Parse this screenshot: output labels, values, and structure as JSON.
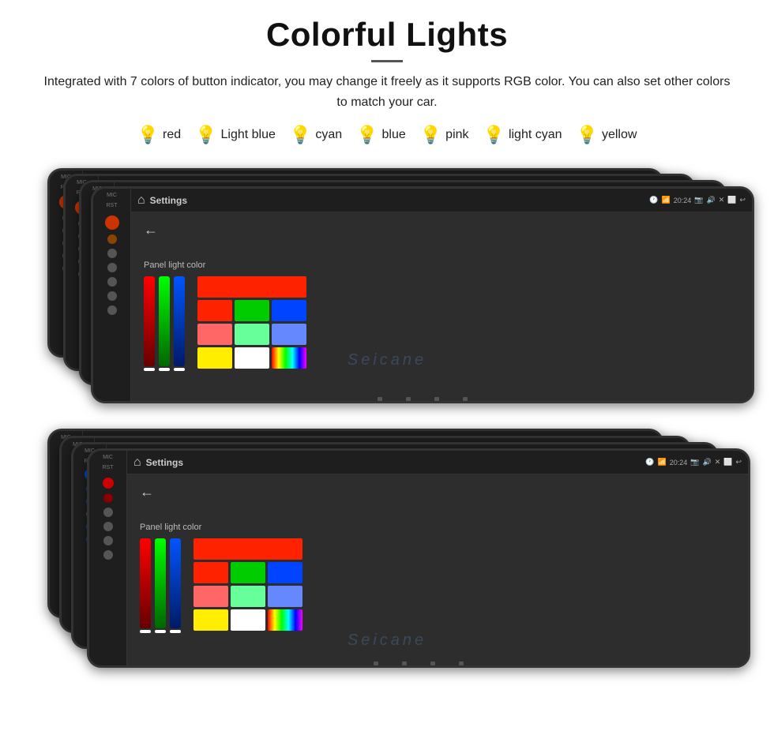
{
  "header": {
    "title": "Colorful Lights",
    "divider": true,
    "description": "Integrated with 7 colors of button indicator, you may change it freely as it supports RGB color. You can also set other colors to match your car."
  },
  "colors": [
    {
      "label": "red",
      "color": "#ff2244",
      "bulb": "🔴"
    },
    {
      "label": "Light blue",
      "color": "#88ccff",
      "bulb": "🔵"
    },
    {
      "label": "cyan",
      "color": "#00eeff",
      "bulb": "🔵"
    },
    {
      "label": "blue",
      "color": "#3344ff",
      "bulb": "🔵"
    },
    {
      "label": "pink",
      "color": "#ff88cc",
      "bulb": "🔴"
    },
    {
      "label": "light cyan",
      "color": "#aaeeff",
      "bulb": "🔵"
    },
    {
      "label": "yellow",
      "color": "#ffee00",
      "bulb": "🟡"
    }
  ],
  "panel": {
    "title": "Panel light color"
  },
  "topbar": {
    "title": "Settings",
    "time": "20:24"
  },
  "watermark": "Seicane"
}
